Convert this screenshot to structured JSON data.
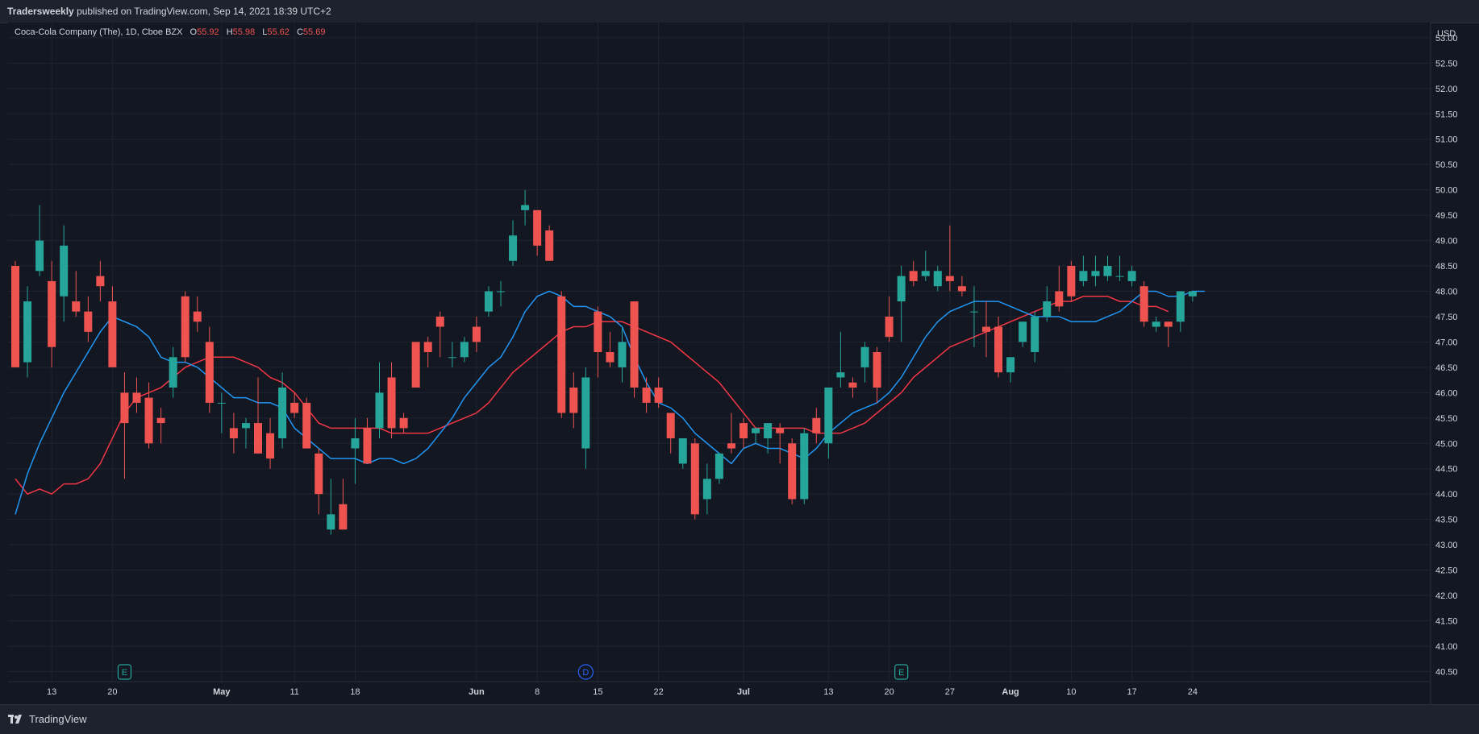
{
  "header": {
    "publisher": "Tradersweekly",
    "published_text": "published on TradingView.com, Sep 14, 2021 18:39 UTC+2"
  },
  "legend": {
    "symbol": "Coca-Cola Company (The), 1D, Cboe BZX",
    "open_label": "O",
    "open_value": "55.92",
    "high_label": "H",
    "high_value": "55.98",
    "low_label": "L",
    "low_value": "55.62",
    "close_label": "C",
    "close_value": "55.69"
  },
  "footer": {
    "brand": "TradingView"
  },
  "colors": {
    "background": "#131722",
    "grid": "#1f2430",
    "up": "#26a69a",
    "down": "#ef5350",
    "ma_fast": "#2196f3",
    "ma_slow": "#f23645"
  },
  "chart_data": {
    "type": "candlestick",
    "currency": "USD",
    "ylim": [
      40.3,
      53.3
    ],
    "y_ticks": [
      "53.00",
      "52.50",
      "52.00",
      "51.50",
      "51.00",
      "50.50",
      "50.00",
      "49.50",
      "49.00",
      "48.50",
      "48.00",
      "47.50",
      "47.00",
      "46.50",
      "46.00",
      "45.50",
      "45.00",
      "44.50",
      "44.00",
      "43.50",
      "43.00",
      "42.50",
      "42.00",
      "41.50",
      "41.00",
      "40.50"
    ],
    "x_ticks": [
      {
        "label": "13",
        "i": 3
      },
      {
        "label": "20",
        "i": 8
      },
      {
        "label": "May",
        "i": 17
      },
      {
        "label": "11",
        "i": 23
      },
      {
        "label": "18",
        "i": 28
      },
      {
        "label": "Jun",
        "i": 38
      },
      {
        "label": "8",
        "i": 43
      },
      {
        "label": "15",
        "i": 48
      },
      {
        "label": "22",
        "i": 53
      },
      {
        "label": "Jul",
        "i": 60
      },
      {
        "label": "13",
        "i": 67
      },
      {
        "label": "20",
        "i": 72
      },
      {
        "label": "27",
        "i": 77
      },
      {
        "label": "Aug",
        "i": 82
      },
      {
        "label": "10",
        "i": 87
      },
      {
        "label": "17",
        "i": 92
      },
      {
        "label": "24",
        "i": 97
      }
    ],
    "events": [
      {
        "label": "E",
        "i": 9,
        "type": "earnings"
      },
      {
        "label": "D",
        "i": 47,
        "type": "dividend"
      },
      {
        "label": "E",
        "i": 73,
        "type": "earnings"
      }
    ],
    "candles": [
      {
        "o": 48.5,
        "h": 48.6,
        "l": 46.5,
        "c": 46.5
      },
      {
        "o": 46.6,
        "h": 48.1,
        "l": 46.3,
        "c": 47.8
      },
      {
        "o": 48.4,
        "h": 49.7,
        "l": 48.3,
        "c": 49.0
      },
      {
        "o": 48.2,
        "h": 48.6,
        "l": 46.5,
        "c": 46.9
      },
      {
        "o": 47.9,
        "h": 49.3,
        "l": 47.4,
        "c": 48.9
      },
      {
        "o": 47.8,
        "h": 48.4,
        "l": 47.5,
        "c": 47.6
      },
      {
        "o": 47.6,
        "h": 47.9,
        "l": 47.0,
        "c": 47.2
      },
      {
        "o": 48.3,
        "h": 48.6,
        "l": 47.8,
        "c": 48.1
      },
      {
        "o": 47.8,
        "h": 48.1,
        "l": 46.6,
        "c": 46.5
      },
      {
        "o": 46.0,
        "h": 46.4,
        "l": 44.3,
        "c": 45.4
      },
      {
        "o": 46.0,
        "h": 46.3,
        "l": 45.6,
        "c": 45.8
      },
      {
        "o": 45.9,
        "h": 46.2,
        "l": 44.9,
        "c": 45.0
      },
      {
        "o": 45.5,
        "h": 45.7,
        "l": 45.0,
        "c": 45.4
      },
      {
        "o": 46.1,
        "h": 46.9,
        "l": 45.9,
        "c": 46.7
      },
      {
        "o": 47.9,
        "h": 48.0,
        "l": 46.6,
        "c": 46.7
      },
      {
        "o": 47.6,
        "h": 47.9,
        "l": 47.2,
        "c": 47.4
      },
      {
        "o": 47.0,
        "h": 47.3,
        "l": 45.6,
        "c": 45.8
      },
      {
        "o": 45.8,
        "h": 46.0,
        "l": 45.2,
        "c": 45.8
      },
      {
        "o": 45.3,
        "h": 45.6,
        "l": 44.8,
        "c": 45.1
      },
      {
        "o": 45.3,
        "h": 45.5,
        "l": 44.9,
        "c": 45.4
      },
      {
        "o": 45.4,
        "h": 46.3,
        "l": 44.8,
        "c": 44.8
      },
      {
        "o": 45.2,
        "h": 45.5,
        "l": 44.5,
        "c": 44.7
      },
      {
        "o": 45.1,
        "h": 46.4,
        "l": 44.9,
        "c": 46.1
      },
      {
        "o": 45.8,
        "h": 46.0,
        "l": 45.5,
        "c": 45.6
      },
      {
        "o": 45.8,
        "h": 45.9,
        "l": 44.9,
        "c": 44.9
      },
      {
        "o": 44.8,
        "h": 44.9,
        "l": 43.6,
        "c": 44.0
      },
      {
        "o": 43.3,
        "h": 44.3,
        "l": 43.2,
        "c": 43.6
      },
      {
        "o": 43.8,
        "h": 44.3,
        "l": 43.3,
        "c": 43.3
      },
      {
        "o": 44.9,
        "h": 45.5,
        "l": 44.2,
        "c": 45.1
      },
      {
        "o": 45.3,
        "h": 45.5,
        "l": 44.6,
        "c": 44.6
      },
      {
        "o": 45.3,
        "h": 46.6,
        "l": 45.1,
        "c": 46.0
      },
      {
        "o": 46.3,
        "h": 46.6,
        "l": 45.1,
        "c": 45.3
      },
      {
        "o": 45.5,
        "h": 45.6,
        "l": 45.2,
        "c": 45.3
      },
      {
        "o": 47.0,
        "h": 47.0,
        "l": 46.1,
        "c": 46.1
      },
      {
        "o": 47.0,
        "h": 47.1,
        "l": 46.5,
        "c": 46.8
      },
      {
        "o": 47.5,
        "h": 47.6,
        "l": 46.7,
        "c": 47.3
      },
      {
        "o": 46.7,
        "h": 47.0,
        "l": 46.5,
        "c": 46.7
      },
      {
        "o": 46.7,
        "h": 47.1,
        "l": 46.6,
        "c": 47.0
      },
      {
        "o": 47.3,
        "h": 47.5,
        "l": 46.8,
        "c": 47.0
      },
      {
        "o": 47.6,
        "h": 48.1,
        "l": 47.5,
        "c": 48.0
      },
      {
        "o": 48.0,
        "h": 48.2,
        "l": 47.7,
        "c": 48.0
      },
      {
        "o": 48.6,
        "h": 49.4,
        "l": 48.5,
        "c": 49.1
      },
      {
        "o": 49.6,
        "h": 50.0,
        "l": 49.3,
        "c": 49.7
      },
      {
        "o": 49.6,
        "h": 49.6,
        "l": 48.7,
        "c": 48.9
      },
      {
        "o": 49.2,
        "h": 49.3,
        "l": 48.6,
        "c": 48.6
      },
      {
        "o": 47.9,
        "h": 48.0,
        "l": 45.5,
        "c": 45.6
      },
      {
        "o": 46.1,
        "h": 46.4,
        "l": 45.3,
        "c": 45.6
      },
      {
        "o": 44.9,
        "h": 46.5,
        "l": 44.5,
        "c": 46.3
      },
      {
        "o": 47.6,
        "h": 47.7,
        "l": 46.3,
        "c": 46.8
      },
      {
        "o": 46.8,
        "h": 47.2,
        "l": 46.5,
        "c": 46.6
      },
      {
        "o": 46.5,
        "h": 47.3,
        "l": 46.2,
        "c": 47.0
      },
      {
        "o": 47.8,
        "h": 47.8,
        "l": 45.9,
        "c": 46.1
      },
      {
        "o": 46.1,
        "h": 46.3,
        "l": 45.6,
        "c": 45.8
      },
      {
        "o": 46.1,
        "h": 46.3,
        "l": 45.7,
        "c": 45.8
      },
      {
        "o": 45.6,
        "h": 45.6,
        "l": 44.8,
        "c": 45.1
      },
      {
        "o": 44.6,
        "h": 45.1,
        "l": 44.5,
        "c": 45.1
      },
      {
        "o": 45.0,
        "h": 45.1,
        "l": 43.5,
        "c": 43.6
      },
      {
        "o": 43.9,
        "h": 44.6,
        "l": 43.6,
        "c": 44.3
      },
      {
        "o": 44.3,
        "h": 44.8,
        "l": 44.2,
        "c": 44.8
      },
      {
        "o": 45.0,
        "h": 45.6,
        "l": 44.8,
        "c": 44.9
      },
      {
        "o": 45.4,
        "h": 45.5,
        "l": 44.9,
        "c": 45.1
      },
      {
        "o": 45.2,
        "h": 45.3,
        "l": 45.0,
        "c": 45.3
      },
      {
        "o": 45.1,
        "h": 45.4,
        "l": 44.8,
        "c": 45.4
      },
      {
        "o": 45.3,
        "h": 45.4,
        "l": 44.6,
        "c": 45.2
      },
      {
        "o": 45.0,
        "h": 45.1,
        "l": 43.8,
        "c": 43.9
      },
      {
        "o": 43.9,
        "h": 45.3,
        "l": 43.8,
        "c": 45.2
      },
      {
        "o": 45.5,
        "h": 45.7,
        "l": 45.0,
        "c": 45.2
      },
      {
        "o": 45.0,
        "h": 46.1,
        "l": 44.7,
        "c": 46.1
      },
      {
        "o": 46.3,
        "h": 47.2,
        "l": 46.1,
        "c": 46.4
      },
      {
        "o": 46.2,
        "h": 46.3,
        "l": 45.9,
        "c": 46.1
      },
      {
        "o": 46.5,
        "h": 47.0,
        "l": 46.2,
        "c": 46.9
      },
      {
        "o": 46.8,
        "h": 46.9,
        "l": 45.8,
        "c": 46.1
      },
      {
        "o": 47.5,
        "h": 47.9,
        "l": 47.0,
        "c": 47.1
      },
      {
        "o": 47.8,
        "h": 48.5,
        "l": 47.0,
        "c": 48.3
      },
      {
        "o": 48.4,
        "h": 48.6,
        "l": 48.1,
        "c": 48.2
      },
      {
        "o": 48.3,
        "h": 48.8,
        "l": 48.2,
        "c": 48.4
      },
      {
        "o": 48.1,
        "h": 48.5,
        "l": 48.0,
        "c": 48.4
      },
      {
        "o": 48.3,
        "h": 49.3,
        "l": 48.0,
        "c": 48.2
      },
      {
        "o": 48.1,
        "h": 48.3,
        "l": 47.9,
        "c": 48.0
      },
      {
        "o": 47.6,
        "h": 48.1,
        "l": 46.9,
        "c": 47.6
      },
      {
        "o": 47.3,
        "h": 47.8,
        "l": 46.7,
        "c": 47.2
      },
      {
        "o": 47.3,
        "h": 47.5,
        "l": 46.3,
        "c": 46.4
      },
      {
        "o": 46.4,
        "h": 46.7,
        "l": 46.2,
        "c": 46.7
      },
      {
        "o": 47.0,
        "h": 47.3,
        "l": 46.9,
        "c": 47.4
      },
      {
        "o": 46.8,
        "h": 47.6,
        "l": 46.6,
        "c": 47.5
      },
      {
        "o": 47.5,
        "h": 48.1,
        "l": 47.4,
        "c": 47.8
      },
      {
        "o": 48.0,
        "h": 48.5,
        "l": 47.6,
        "c": 47.7
      },
      {
        "o": 48.5,
        "h": 48.6,
        "l": 47.8,
        "c": 47.9
      },
      {
        "o": 48.2,
        "h": 48.7,
        "l": 48.1,
        "c": 48.4
      },
      {
        "o": 48.3,
        "h": 48.7,
        "l": 48.1,
        "c": 48.4
      },
      {
        "o": 48.3,
        "h": 48.7,
        "l": 48.2,
        "c": 48.5
      },
      {
        "o": 48.3,
        "h": 48.7,
        "l": 48.2,
        "c": 48.3
      },
      {
        "o": 48.2,
        "h": 48.5,
        "l": 48.1,
        "c": 48.4
      },
      {
        "o": 48.1,
        "h": 48.2,
        "l": 47.3,
        "c": 47.4
      },
      {
        "o": 47.3,
        "h": 47.5,
        "l": 47.2,
        "c": 47.4
      },
      {
        "o": 47.4,
        "h": 47.4,
        "l": 46.9,
        "c": 47.3
      },
      {
        "o": 47.4,
        "h": 48.0,
        "l": 47.2,
        "c": 48.0
      },
      {
        "o": 47.9,
        "h": 48.0,
        "l": 47.8,
        "c": 48.0
      }
    ],
    "ma_fast": [
      43.6,
      44.4,
      45.0,
      45.5,
      46.0,
      46.4,
      46.8,
      47.2,
      47.5,
      47.4,
      47.3,
      47.1,
      46.7,
      46.6,
      46.6,
      46.5,
      46.3,
      46.1,
      45.9,
      45.9,
      45.8,
      45.8,
      45.7,
      45.3,
      45.1,
      44.9,
      44.7,
      44.7,
      44.7,
      44.6,
      44.7,
      44.7,
      44.6,
      44.7,
      44.9,
      45.2,
      45.5,
      45.9,
      46.2,
      46.5,
      46.7,
      47.1,
      47.6,
      47.9,
      48.0,
      47.9,
      47.7,
      47.7,
      47.6,
      47.5,
      47.3,
      46.7,
      46.2,
      45.8,
      45.7,
      45.5,
      45.2,
      45.0,
      44.8,
      44.6,
      44.9,
      45.0,
      44.9,
      44.9,
      44.8,
      44.7,
      44.9,
      45.2,
      45.4,
      45.6,
      45.7,
      45.8,
      46.0,
      46.3,
      46.7,
      47.1,
      47.4,
      47.6,
      47.7,
      47.8,
      47.8,
      47.8,
      47.7,
      47.6,
      47.5,
      47.5,
      47.5,
      47.4,
      47.4,
      47.4,
      47.5,
      47.6,
      47.8,
      48.0,
      48.0,
      47.9,
      47.9,
      48.0,
      48.0
    ],
    "ma_slow": [
      44.3,
      44.0,
      44.1,
      44.0,
      44.2,
      44.2,
      44.3,
      44.6,
      45.1,
      45.6,
      45.9,
      46.0,
      46.1,
      46.3,
      46.5,
      46.6,
      46.7,
      46.7,
      46.7,
      46.6,
      46.5,
      46.3,
      46.2,
      46.0,
      45.7,
      45.4,
      45.3,
      45.3,
      45.3,
      45.3,
      45.3,
      45.2,
      45.2,
      45.2,
      45.2,
      45.3,
      45.4,
      45.5,
      45.6,
      45.8,
      46.1,
      46.4,
      46.6,
      46.8,
      47.0,
      47.2,
      47.3,
      47.3,
      47.4,
      47.4,
      47.4,
      47.3,
      47.2,
      47.1,
      47.0,
      46.8,
      46.6,
      46.4,
      46.2,
      45.9,
      45.6,
      45.3,
      45.3,
      45.3,
      45.3,
      45.3,
      45.2,
      45.2,
      45.2,
      45.3,
      45.4,
      45.6,
      45.8,
      46.0,
      46.3,
      46.5,
      46.7,
      46.9,
      47.0,
      47.1,
      47.2,
      47.3,
      47.4,
      47.5,
      47.6,
      47.7,
      47.8,
      47.8,
      47.9,
      47.9,
      47.9,
      47.8,
      47.8,
      47.7,
      47.7,
      47.6
    ]
  }
}
